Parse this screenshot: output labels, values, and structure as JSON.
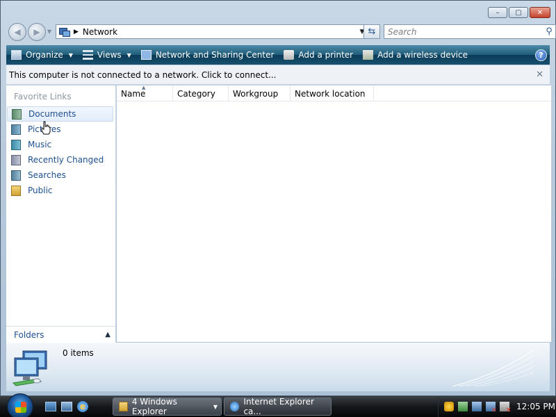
{
  "window": {
    "caption_buttons": {
      "minimize": "–",
      "maximize": "▢",
      "close": "✕"
    }
  },
  "address_bar": {
    "breadcrumb": "Network",
    "search_placeholder": "Search"
  },
  "toolbar": {
    "organize": "Organize",
    "views": "Views",
    "network_sharing_center": "Network and Sharing Center",
    "add_printer": "Add a printer",
    "add_wireless": "Add a wireless device",
    "help": "?"
  },
  "infobar": {
    "message": "This computer is not connected to a network. Click to connect..."
  },
  "nav_pane": {
    "favorite_links_title": "Favorite Links",
    "items": [
      {
        "label": "Documents",
        "icon": "documents-icon",
        "selected": true
      },
      {
        "label": "Pictures",
        "icon": "pictures-icon",
        "selected": false
      },
      {
        "label": "Music",
        "icon": "music-icon",
        "selected": false
      },
      {
        "label": "Recently Changed",
        "icon": "recently-changed-icon",
        "selected": false
      },
      {
        "label": "Searches",
        "icon": "searches-icon",
        "selected": false
      },
      {
        "label": "Public",
        "icon": "public-folder-icon",
        "selected": false
      }
    ],
    "folders_label": "Folders"
  },
  "content": {
    "columns": [
      "Name",
      "Category",
      "Workgroup",
      "Network location"
    ]
  },
  "details": {
    "item_count": "0 items"
  },
  "taskbar": {
    "tasks": [
      {
        "label": "4 Windows Explorer"
      },
      {
        "label": "Internet Explorer ca..."
      }
    ],
    "clock": "12:05 PM"
  },
  "colors": {
    "toolbar_bg": "#17506f",
    "link_blue": "#1d4f91",
    "taskbar_bg": "#15181b"
  }
}
